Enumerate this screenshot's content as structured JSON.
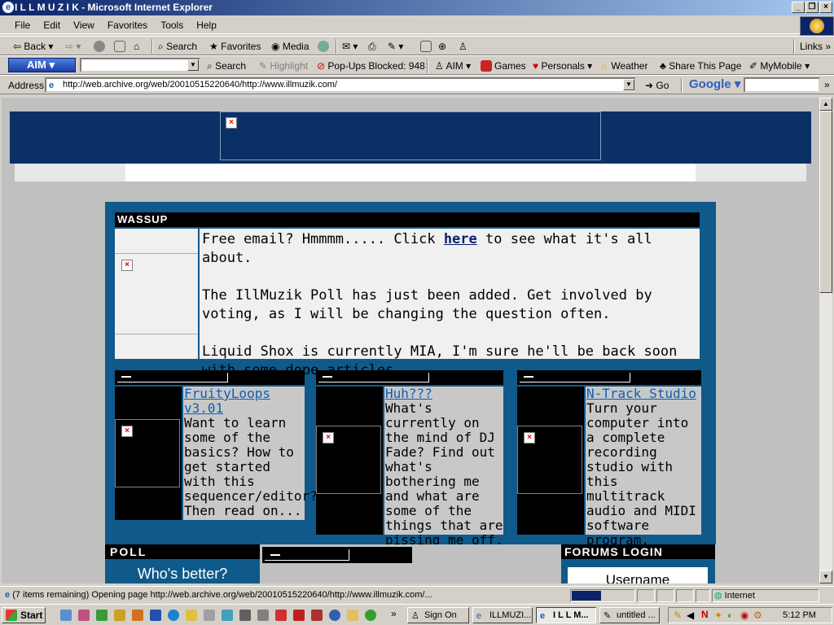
{
  "window": {
    "title": "I L L M U Z I K - Microsoft Internet Explorer"
  },
  "menu": [
    "File",
    "Edit",
    "View",
    "Favorites",
    "Tools",
    "Help"
  ],
  "toolbar": {
    "back": "Back",
    "search": "Search",
    "favorites": "Favorites",
    "media": "Media"
  },
  "links_label": "Links",
  "aim_bar": {
    "aim_label": "AIM",
    "search": "Search",
    "highlight": "Highlight",
    "popups": "Pop-Ups Blocked: 948",
    "aim_menu": "AIM",
    "games": "Games",
    "personals": "Personals",
    "weather": "Weather",
    "share": "Share This Page",
    "mymobile": "MyMobile"
  },
  "address_bar": {
    "label": "Address",
    "url": "http://web.archive.org/web/20010515220640/http://www.illmuzik.com/",
    "go": "Go",
    "google": "Google"
  },
  "page": {
    "wassup_title": "WASSUP",
    "news": {
      "p1_before": "Free email? Hmmmm..... Click ",
      "p1_link": "here",
      "p1_after": " to see what it's all about.",
      "p2": "The IllMuzik Poll has just been added. Get involved by voting, as I will be changing the question often.",
      "p3": "Liquid Shox is currently MIA, I'm sure he'll be back soon with some dope articles."
    },
    "columns": [
      {
        "title": "FruityLoops v3.01",
        "text": "Want to learn some of the basics? How to get started with this sequencer/editor? Then read on..."
      },
      {
        "title": "Huh???",
        "text": "What's currently on the mind of DJ Fade? Find out what's bothering me and what are some of the things that are pissing me off."
      },
      {
        "title": "N-Track Studio",
        "text": "Turn your computer into a complete recording studio with this multitrack audio and MIDI software program."
      }
    ],
    "poll_title": "POLL",
    "poll_question": "Who's better?",
    "forums_title": "FORUMS LOGIN",
    "username_label": "Username"
  },
  "status_bar": {
    "text": "(7 items remaining) Opening page http://web.archive.org/web/20010515220640/http://www.illmuzik.com/...",
    "zone": "Internet"
  },
  "taskbar": {
    "start": "Start",
    "tasks": [
      "Sign On",
      "ILLMUZI...",
      "I L L M...",
      "untitled ..."
    ],
    "clock": "5:12 PM"
  }
}
